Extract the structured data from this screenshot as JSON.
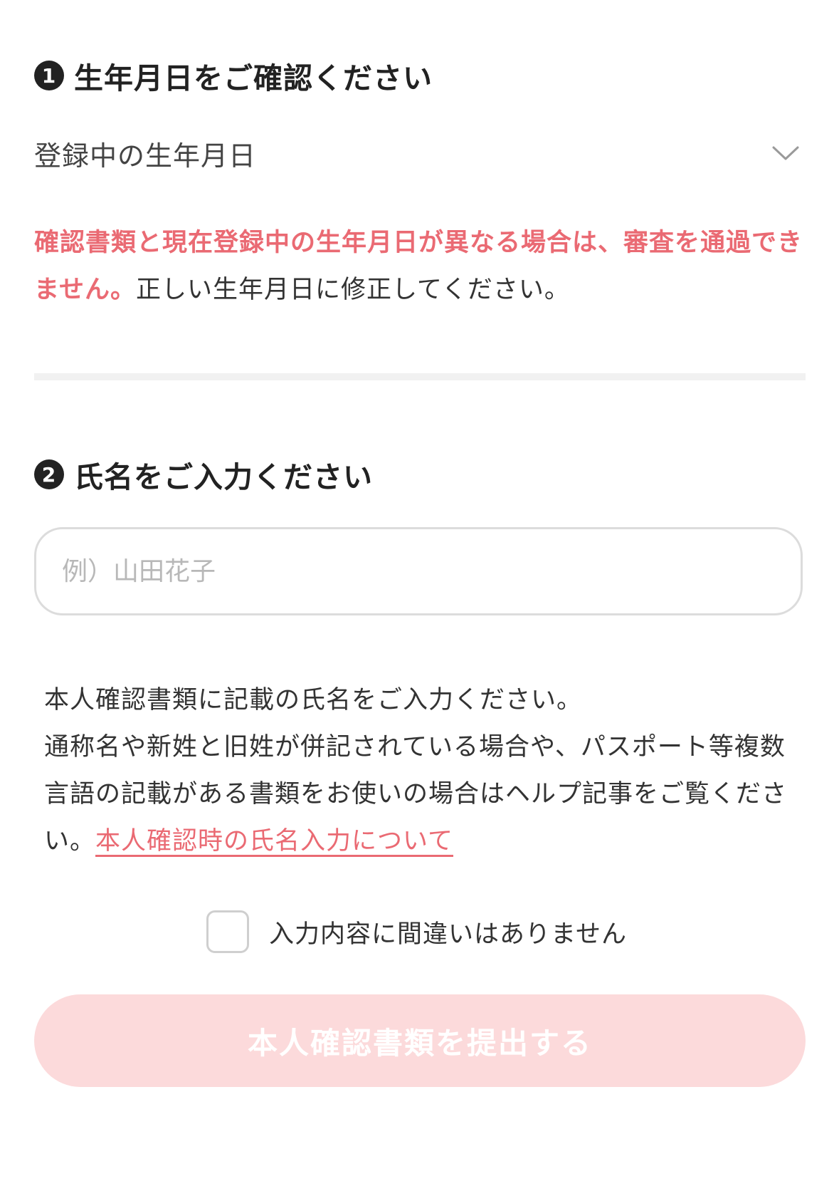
{
  "section1": {
    "badge": "1",
    "title": "生年月日をご確認ください",
    "dob_select_label": "登録中の生年月日",
    "warning_red": "確認書類と現在登録中の生年月日が異なる場合は、審査を通過できません。",
    "warning_normal": "正しい生年月日に修正してください。"
  },
  "section2": {
    "badge": "2",
    "title": "氏名をご入力ください",
    "name_input_value": "",
    "name_input_placeholder": "例）山田花子",
    "help_line1": "本人確認書類に記載の氏名をご入力ください。",
    "help_line2": "通称名や新姓と旧姓が併記されている場合や、パスポート等複数言語の記載がある書類をお使いの場合はヘルプ記事をご覧ください。",
    "help_link": "本人確認時の氏名入力について",
    "confirm_label": "入力内容に間違いはありません"
  },
  "submit_button_label": "本人確認書類を提出する",
  "colors": {
    "accent_red": "#ea6a73",
    "button_disabled_bg": "#fcdadb",
    "text_dark": "#222222",
    "border_gray": "#dcdcdc"
  },
  "icons": {
    "dob_select": "chevron-down-icon",
    "step1": "number-one-circle-icon",
    "step2": "number-two-circle-icon"
  }
}
